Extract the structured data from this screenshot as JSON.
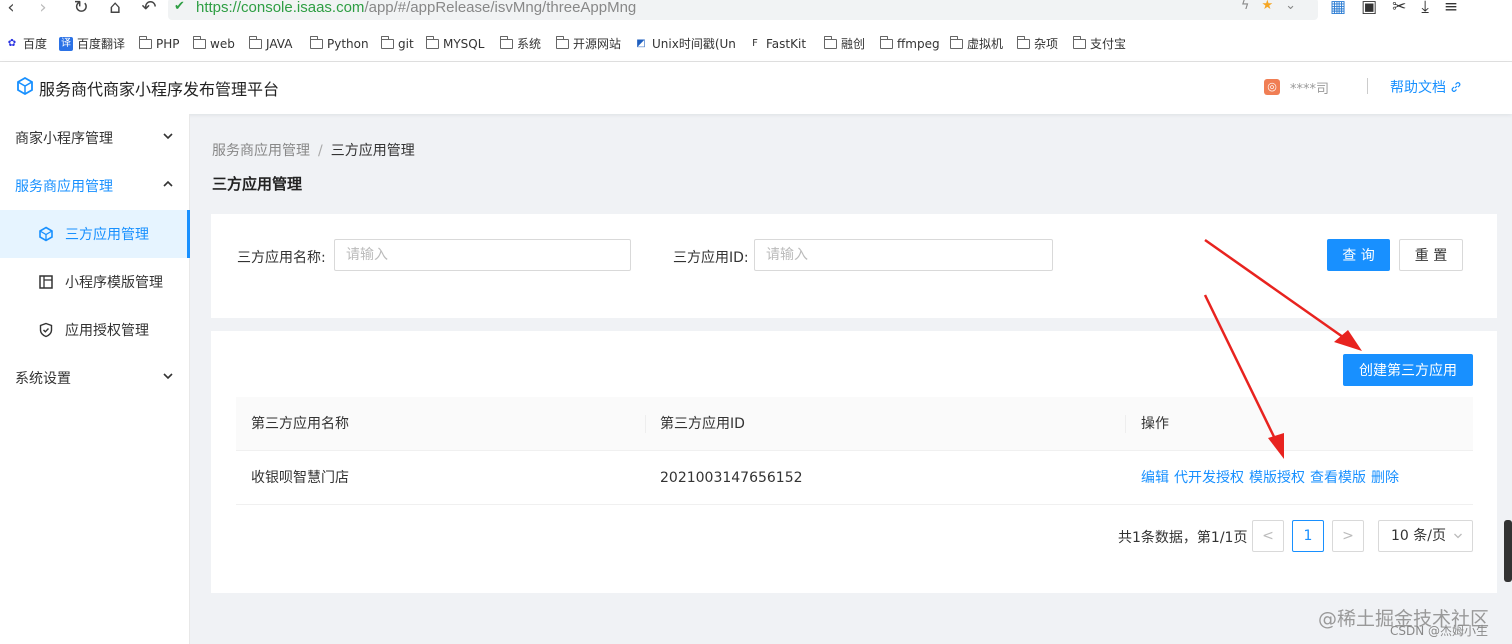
{
  "browser": {
    "url_scheme": "https://",
    "url_host": "console.isaas.com",
    "url_path": "/app/#/appRelease/isvMng/threeAppMng",
    "bookmarks": [
      {
        "label": "百度",
        "icon": "baidu-icon"
      },
      {
        "label": "百度翻译",
        "icon": "translate-icon"
      },
      {
        "label": "PHP",
        "icon": "folder-icon"
      },
      {
        "label": "web",
        "icon": "folder-icon"
      },
      {
        "label": "JAVA",
        "icon": "folder-icon"
      },
      {
        "label": "Python",
        "icon": "folder-icon"
      },
      {
        "label": "git",
        "icon": "folder-icon"
      },
      {
        "label": "MYSQL",
        "icon": "folder-icon"
      },
      {
        "label": "系统",
        "icon": "folder-icon"
      },
      {
        "label": "开源网站",
        "icon": "folder-icon"
      },
      {
        "label": "Unix时间戳(Un",
        "icon": "unix-icon"
      },
      {
        "label": "FastKit",
        "icon": "fastkit-icon"
      },
      {
        "label": "融创",
        "icon": "folder-icon"
      },
      {
        "label": "ffmpeg",
        "icon": "folder-icon"
      },
      {
        "label": "虚拟机",
        "icon": "folder-icon"
      },
      {
        "label": "杂项",
        "icon": "folder-icon"
      },
      {
        "label": "支付宝",
        "icon": "folder-icon"
      }
    ]
  },
  "header": {
    "title": "服务商代商家小程序发布管理平台",
    "org_name": "****司",
    "help_label": "帮助文档"
  },
  "sidebar": {
    "groups": [
      {
        "label": "商家小程序管理"
      },
      {
        "label": "服务商应用管理"
      },
      {
        "label": "系统设置"
      }
    ],
    "items": [
      {
        "label": "三方应用管理",
        "icon": "app-icon"
      },
      {
        "label": "小程序模版管理",
        "icon": "template-icon"
      },
      {
        "label": "应用授权管理",
        "icon": "shield-check-icon"
      }
    ]
  },
  "breadcrumb": {
    "parent": "服务商应用管理",
    "separator": "/",
    "current": "三方应用管理"
  },
  "page_title": "三方应用管理",
  "filter": {
    "name_label": "三方应用名称:",
    "name_placeholder": "请输入",
    "id_label": "三方应用ID:",
    "id_placeholder": "请输入",
    "query_label": "查 询",
    "reset_label": "重 置"
  },
  "create_label": "创建第三方应用",
  "table": {
    "columns": [
      "第三方应用名称",
      "第三方应用ID",
      "操作"
    ],
    "rows": [
      {
        "name": "收银呗智慧门店",
        "id": "2021003147656152",
        "actions": [
          "编辑",
          "代开发授权",
          "模版授权",
          "查看模版",
          "删除"
        ]
      }
    ]
  },
  "pagination": {
    "total_text": "共1条数据，第1/1页",
    "current_page": "1",
    "prev": "<",
    "next": ">",
    "page_size": "10 条/页"
  },
  "watermark": {
    "main": "@稀土掘金技术社区",
    "sub": "CSDN @杰姆小生"
  },
  "colors": {
    "primary": "#1890ff",
    "arrow": "#e8231f",
    "url_green": "#2e9e43"
  }
}
